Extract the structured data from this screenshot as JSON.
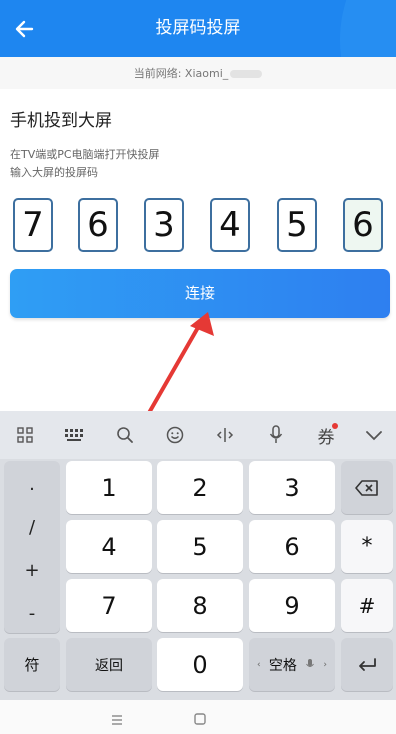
{
  "header": {
    "title": "投屏码投屏",
    "back_icon": "arrow-left-icon",
    "bg_color": "#1e86f0"
  },
  "network": {
    "label": "当前网络: Xiaomi_"
  },
  "main": {
    "heading": "手机投到大屏",
    "hint_line1": "在TV端或PC电脑端打开快投屏",
    "hint_line2": "输入大屏的投屏码",
    "code_digits": [
      "7",
      "6",
      "3",
      "4",
      "5",
      "6"
    ],
    "connect_label": "连接"
  },
  "keyboard": {
    "toolbar_icons": [
      "grid-icon",
      "keyboard-icon",
      "search-icon",
      "emoji-icon",
      "cursor-icon",
      "microphone-icon",
      "coupon-icon",
      "chevron-down-icon"
    ],
    "toolbar_coupon_glyph": "券",
    "left_column": [
      ".",
      "/",
      "+",
      "-"
    ],
    "digits": [
      "1",
      "2",
      "3",
      "4",
      "5",
      "6",
      "7",
      "8",
      "9",
      "0"
    ],
    "right_keys": {
      "backspace_icon": "backspace-icon",
      "star": "*",
      "hash": "#"
    },
    "symbols_label": "符",
    "back_label": "返回",
    "space_label": "空格",
    "enter_icon": "enter-icon"
  },
  "navbar": {
    "icons": [
      "menu-icon",
      "home-icon"
    ]
  }
}
